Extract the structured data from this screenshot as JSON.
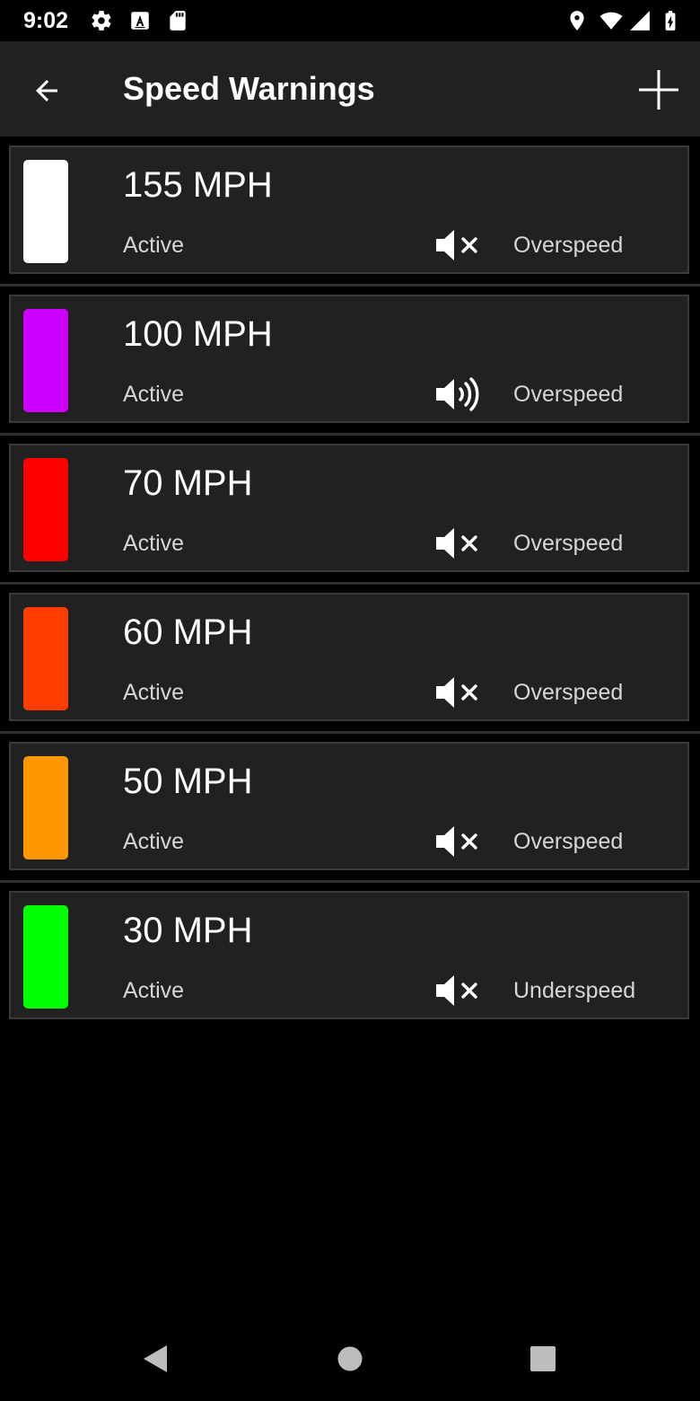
{
  "status_bar": {
    "time": "9:02",
    "icons": [
      "gear-icon",
      "a-badge-icon",
      "sd-card-icon",
      "location-icon",
      "wifi-icon",
      "cell-signal-icon",
      "battery-charging-icon"
    ]
  },
  "app_bar": {
    "title": "Speed Warnings",
    "back_icon": "arrow-left-icon",
    "add_icon": "plus-icon"
  },
  "warnings": [
    {
      "speed": "155 MPH",
      "state": "Active",
      "sound": "muted",
      "type": "Overspeed",
      "color": "#ffffff"
    },
    {
      "speed": "100 MPH",
      "state": "Active",
      "sound": "on",
      "type": "Overspeed",
      "color": "#cc00ff"
    },
    {
      "speed": "70 MPH",
      "state": "Active",
      "sound": "muted",
      "type": "Overspeed",
      "color": "#ff0000"
    },
    {
      "speed": "60 MPH",
      "state": "Active",
      "sound": "muted",
      "type": "Overspeed",
      "color": "#ff3d00"
    },
    {
      "speed": "50 MPH",
      "state": "Active",
      "sound": "muted",
      "type": "Overspeed",
      "color": "#ff9800"
    },
    {
      "speed": "30 MPH",
      "state": "Active",
      "sound": "muted",
      "type": "Underspeed",
      "color": "#00ff00"
    }
  ],
  "nav_bar": {
    "icons": [
      "back-triangle-icon",
      "home-circle-icon",
      "recents-square-icon"
    ]
  }
}
